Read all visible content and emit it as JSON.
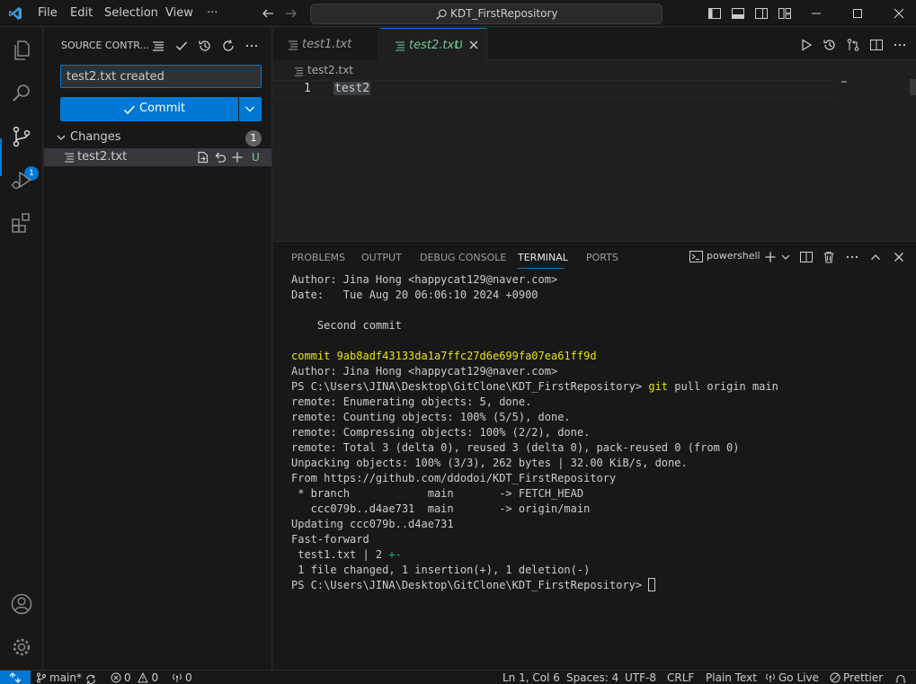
{
  "titlebar": {
    "menus": [
      "File",
      "Edit",
      "Selection",
      "View",
      "···"
    ],
    "command_center": "KDT_FirstRepository"
  },
  "activitybar": {
    "items": [
      "files-icon",
      "search-icon",
      "source-control-icon",
      "run-debug-icon",
      "extensions-icon"
    ],
    "source_control_badge": "1"
  },
  "sidebar": {
    "title": "SOURCE CONTR...",
    "commit_message": "test2.txt created",
    "commit_label": "Commit",
    "changes_label": "Changes",
    "changes_count": "1",
    "files": [
      {
        "name": "test2.txt",
        "status": "U"
      }
    ]
  },
  "editor": {
    "tabs": [
      {
        "name": "test1.txt"
      },
      {
        "name": "test2.txt",
        "status": "U"
      }
    ],
    "breadcrumb": "test2.txt",
    "line_number": "1",
    "line_text": "test2"
  },
  "panel": {
    "tabs": [
      "PROBLEMS",
      "OUTPUT",
      "DEBUG CONSOLE",
      "TERMINAL",
      "PORTS"
    ],
    "active_tab": "TERMINAL",
    "shell": "powershell",
    "terminal_lines": [
      {
        "text": "Author: Jina Hong <happycat129@naver.com>"
      },
      {
        "text": "Date:   Tue Aug 20 06:06:10 2024 +0900"
      },
      {
        "text": ""
      },
      {
        "text": "    Second commit"
      },
      {
        "text": ""
      },
      {
        "text": "commit 9ab8adf43133da1a7ffc27d6e699fa07ea61ff9d",
        "color": "yellow"
      },
      {
        "text": "Author: Jina Hong <happycat129@naver.com>"
      },
      {
        "text": "PS C:\\Users\\JINA\\Desktop\\GitClone\\KDT_FirstRepository> ",
        "cmd": "git",
        "args": " pull origin main"
      },
      {
        "text": "remote: Enumerating objects: 5, done."
      },
      {
        "text": "remote: Counting objects: 100% (5/5), done."
      },
      {
        "text": "remote: Compressing objects: 100% (2/2), done."
      },
      {
        "text": "remote: Total 3 (delta 0), reused 3 (delta 0), pack-reused 0 (from 0)"
      },
      {
        "text": "Unpacking objects: 100% (3/3), 262 bytes | 32.00 KiB/s, done."
      },
      {
        "text": "From https://github.com/ddodoi/KDT_FirstRepository"
      },
      {
        "text": " * branch            main       -> FETCH_HEAD"
      },
      {
        "text": "   ccc079b..d4ae731  main       -> origin/main"
      },
      {
        "text": "Updating ccc079b..d4ae731"
      },
      {
        "text": "Fast-forward"
      },
      {
        "text": " test1.txt | 2 ",
        "diff": "+-"
      },
      {
        "text": " 1 file changed, 1 insertion(+), 1 deletion(-)"
      },
      {
        "text": "PS C:\\Users\\JINA\\Desktop\\GitClone\\KDT_FirstRepository> ",
        "cursor": true
      }
    ]
  },
  "statusbar": {
    "branch": "main*",
    "errors": "0",
    "warnings": "0",
    "ports": "0",
    "position": "Ln 1, Col 6",
    "spaces": "Spaces: 4",
    "encoding": "UTF-8",
    "eol": "CRLF",
    "language": "Plain Text",
    "go_live": "Go Live",
    "prettier": "Prettier"
  },
  "colors": {
    "accent": "#0078d4",
    "untracked": "#73c991",
    "commit_hash": "#e5e510",
    "diff_add": "#0dbc79"
  }
}
